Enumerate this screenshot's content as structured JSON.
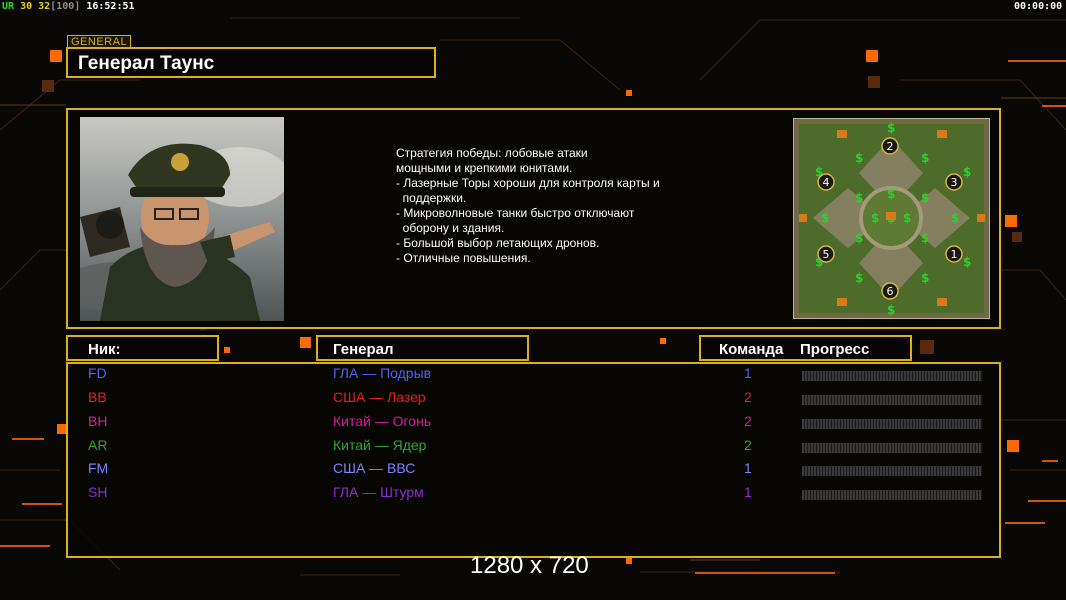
{
  "hud": {
    "left_tag": "UR",
    "fps_a": "30",
    "fps_b": "32",
    "bracket_value": "[100]",
    "clock": "16:52:51",
    "right_timer": "00:00:00"
  },
  "general_tag": "GENERAL",
  "general_title": "Генерал Таунс",
  "description": [
    "Стратегия победы: лобовые атаки",
    "мощными и крепкими юнитами.",
    "",
    "- Лазерные Торы хороши для контроля карты и",
    "  поддержки.",
    "- Микроволновые танки быстро отключают",
    "  оборону и здания.",
    "",
    "- Большой выбор летающих дронов.",
    "- Отличные повышения."
  ],
  "map": {
    "start_positions": [
      "2",
      "4",
      "3",
      "5",
      "1",
      "6"
    ]
  },
  "columns": {
    "nick": "Ник:",
    "general": "Генерал",
    "team": "Команда",
    "progress": "Прогресс"
  },
  "players": [
    {
      "nick": "FD",
      "general": "ГЛА — Подрыв",
      "team": "1",
      "color": "#4f62f2",
      "progress": 0
    },
    {
      "nick": "BB",
      "general": "США — Лазер",
      "team": "2",
      "color": "#e81e1e",
      "progress": 0
    },
    {
      "nick": "BH",
      "general": "Китай — Огонь",
      "team": "2",
      "color": "#d21f9e",
      "progress": 0
    },
    {
      "nick": "AR",
      "general": "Китай — Ядер",
      "team": "2",
      "color": "#2ea52e",
      "progress": 0
    },
    {
      "nick": "FM",
      "general": "США — ВВС",
      "team": "1",
      "color": "#7f82ff",
      "progress": 0
    },
    {
      "nick": "SH",
      "general": "ГЛА — Штурм",
      "team": "1",
      "color": "#8b2fd0",
      "progress": 0
    }
  ],
  "resolution_label": "1280 x 720",
  "colors": {
    "accent": "#d9b21a",
    "orange": "#ff6a00"
  }
}
